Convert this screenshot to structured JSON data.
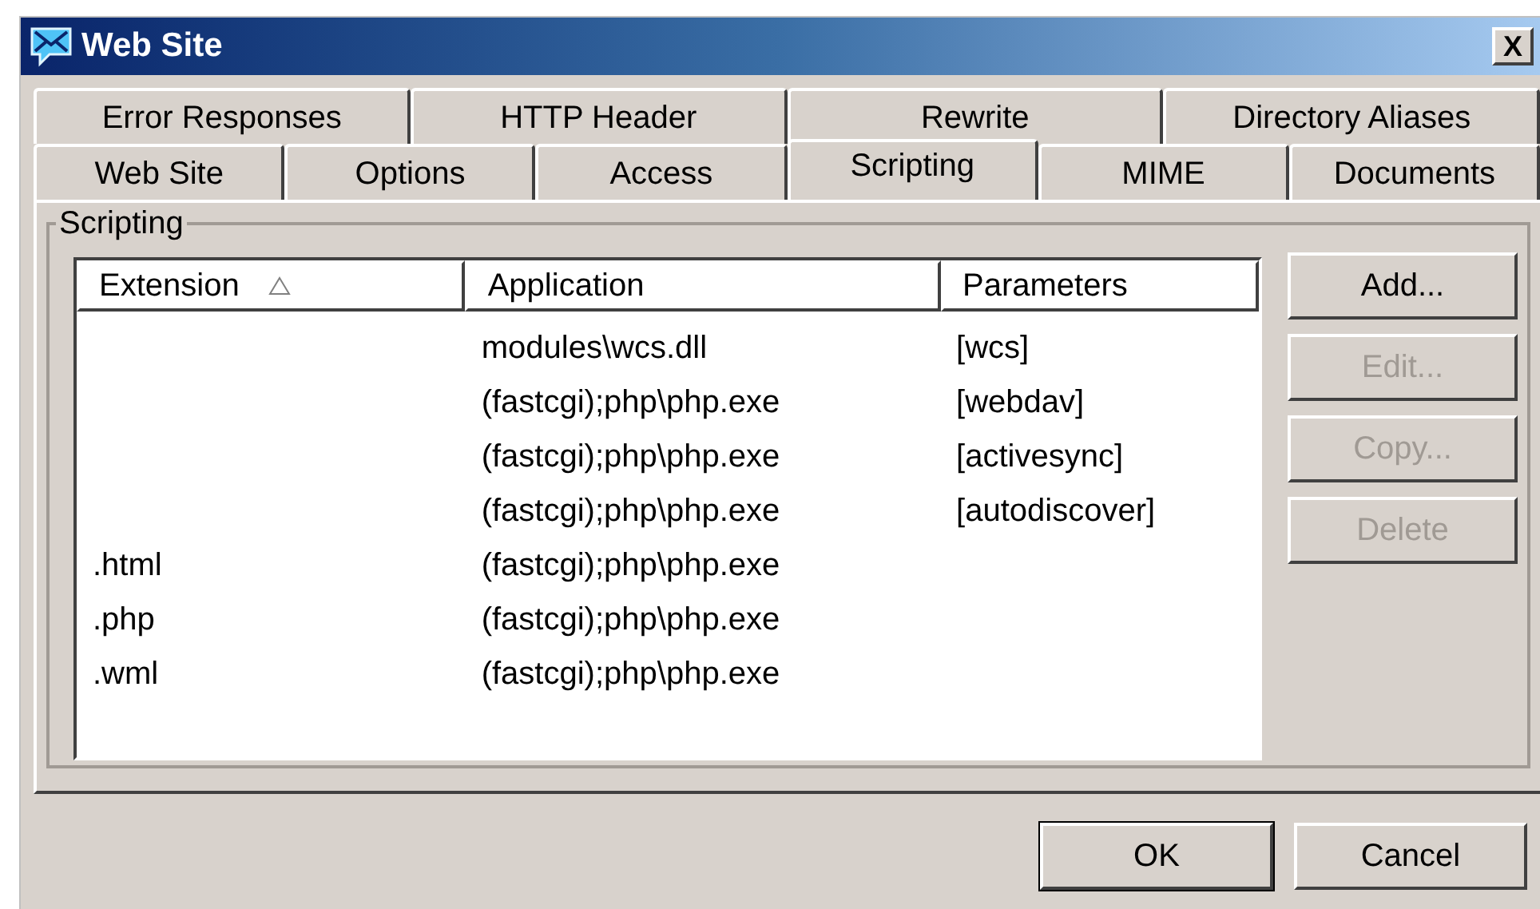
{
  "window": {
    "title": "Web Site",
    "close": "X"
  },
  "tab_rows": [
    [
      {
        "label": "Error Responses",
        "selected": false
      },
      {
        "label": "HTTP Header",
        "selected": false
      },
      {
        "label": "Rewrite",
        "selected": false
      },
      {
        "label": "Directory Aliases",
        "selected": false
      }
    ],
    [
      {
        "label": "Web Site",
        "selected": false
      },
      {
        "label": "Options",
        "selected": false
      },
      {
        "label": "Access",
        "selected": false
      },
      {
        "label": "Scripting",
        "selected": true
      },
      {
        "label": "MIME",
        "selected": false
      },
      {
        "label": "Documents",
        "selected": false
      }
    ]
  ],
  "group": {
    "title": "Scripting"
  },
  "table": {
    "columns": [
      {
        "label": "Extension",
        "sorted": true
      },
      {
        "label": "Application",
        "sorted": false
      },
      {
        "label": "Parameters",
        "sorted": false
      }
    ],
    "rows": [
      [
        "",
        "modules\\wcs.dll",
        "[wcs]"
      ],
      [
        "",
        "(fastcgi);php\\php.exe",
        "[webdav]"
      ],
      [
        "",
        "(fastcgi);php\\php.exe",
        "[activesync]"
      ],
      [
        "",
        "(fastcgi);php\\php.exe",
        "[autodiscover]"
      ],
      [
        ".html",
        "(fastcgi);php\\php.exe",
        ""
      ],
      [
        ".php",
        "(fastcgi);php\\php.exe",
        ""
      ],
      [
        ".wml",
        "(fastcgi);php\\php.exe",
        ""
      ]
    ]
  },
  "side_buttons": [
    {
      "label": "Add...",
      "disabled": false
    },
    {
      "label": "Edit...",
      "disabled": true
    },
    {
      "label": "Copy...",
      "disabled": true
    },
    {
      "label": "Delete",
      "disabled": true
    }
  ],
  "footer_buttons": [
    {
      "label": "OK",
      "default": true
    },
    {
      "label": "Cancel",
      "default": false
    }
  ]
}
